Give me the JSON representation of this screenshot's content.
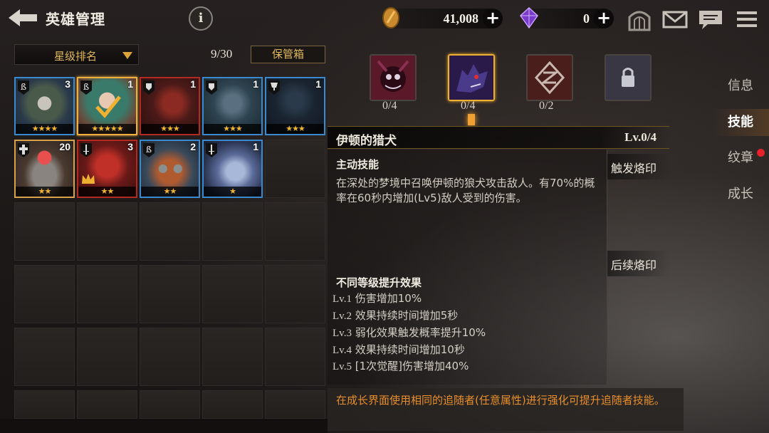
{
  "header": {
    "title": "英雄管理",
    "info_label": "i"
  },
  "currencies": [
    {
      "name": "gold",
      "value": "41,008",
      "plus": "+",
      "icon": "coin-icon",
      "color": "#d4963a"
    },
    {
      "name": "gem",
      "value": "0",
      "plus": "+",
      "icon": "gem-icon",
      "color": "#8a4ad8"
    }
  ],
  "top_icons": [
    "gate-icon",
    "mail-icon",
    "chat-icon",
    "menu-icon"
  ],
  "left_panel": {
    "sort_label": "星级排名",
    "count": "9/30",
    "vault_label": "保管箱",
    "heroes": [
      {
        "level": "3",
        "stars": "★★★★",
        "badge": "class-b-icon",
        "color": "#3a8ad0"
      },
      {
        "level": "1",
        "stars": "★★★★★",
        "badge": "class-b-icon",
        "color": "#d8a24a"
      },
      {
        "level": "1",
        "stars": "★★★",
        "badge": "shield-icon",
        "color": "#b52a20"
      },
      {
        "level": "1",
        "stars": "★★★",
        "badge": "shield-icon",
        "color": "#3a8ad0"
      },
      {
        "level": "1",
        "stars": "★★★",
        "badge": "trophy-icon",
        "color": "#3a8ad0"
      },
      {
        "level": "20",
        "stars": "★★",
        "badge": "cross-icon",
        "color": "#d8a24a"
      },
      {
        "level": "3",
        "stars": "★★",
        "badge": "sword-icon",
        "color": "#b52a20"
      },
      {
        "level": "2",
        "stars": "★★",
        "badge": "class-b-icon",
        "color": "#3a8ad0"
      },
      {
        "level": "1",
        "stars": "★",
        "badge": "sword-icon",
        "color": "#3a8ad0"
      }
    ]
  },
  "skills": [
    {
      "count": "0/4",
      "icon": "demon-mask-icon"
    },
    {
      "count": "0/4",
      "icon": "wolf-hound-icon"
    },
    {
      "count": "0/2",
      "icon": "rune-knot-icon"
    },
    {
      "count": "",
      "icon": "lock-icon"
    }
  ],
  "tabs": [
    {
      "label": "信息"
    },
    {
      "label": "技能"
    },
    {
      "label": "纹章"
    },
    {
      "label": "成长"
    }
  ],
  "skill_detail": {
    "name": "伊顿的猎犬",
    "level": "Lv.0/4",
    "active_title": "主动技能",
    "description": "在深处的梦境中召唤伊顿的狼犬攻击敌人。有70%的概率在60秒内增加(Lv5)敌人受到的伤害。",
    "upgrade_title": "不同等级提升效果",
    "upgrades": [
      {
        "lv": "Lv.1",
        "text": "伤害增加10%"
      },
      {
        "lv": "Lv.2",
        "text": "效果持续时间增加5秒"
      },
      {
        "lv": "Lv.3",
        "text": "弱化效果触发概率提升10%"
      },
      {
        "lv": "Lv.4",
        "text": "效果持续时间增加10秒"
      },
      {
        "lv": "Lv.5",
        "text": "[1次觉醒]伤害增加40%"
      }
    ],
    "trigger_imprint": "触发烙印",
    "followup_imprint": "后续烙印"
  },
  "tip": "在成长界面使用相同的追随者(任意属性)进行强化可提升追随者技能。"
}
